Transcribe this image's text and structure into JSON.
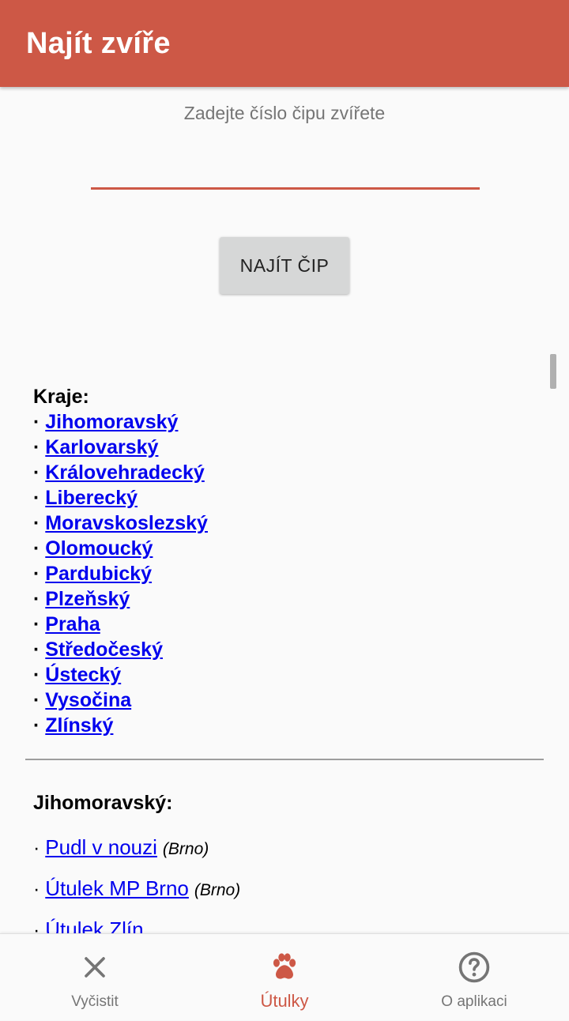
{
  "appbar": {
    "title": "Najít zvíře"
  },
  "search": {
    "hint": "Zadejte číslo čipu zvířete",
    "value": "",
    "button_label": "NAJÍT ČIP"
  },
  "regions": {
    "heading": "Kraje:",
    "items": [
      "Jihomoravský",
      "Karlovarský",
      "Královehradecký",
      "Liberecký",
      "Moravskoslezský",
      "Olomoucký",
      "Pardubický",
      "Plzeňský",
      "Praha",
      "Středočeský",
      "Ústecký",
      "Vysočina",
      "Zlínský"
    ]
  },
  "section": {
    "title": "Jihomoravský:",
    "shelters": [
      {
        "name": "Pudl v nouzi",
        "city": "(Brno)"
      },
      {
        "name": "Útulek MP Brno",
        "city": "(Brno)"
      },
      {
        "name": "Útulek Zlín",
        "city": ""
      }
    ]
  },
  "bottom_nav": {
    "items": [
      {
        "label": "Vyčistit",
        "icon": "close-icon",
        "active": false
      },
      {
        "label": "Útulky",
        "icon": "paw-icon",
        "active": true
      },
      {
        "label": "O aplikaci",
        "icon": "help-circle-icon",
        "active": false
      }
    ]
  },
  "colors": {
    "accent": "#cd5846",
    "link": "#0000ee"
  }
}
